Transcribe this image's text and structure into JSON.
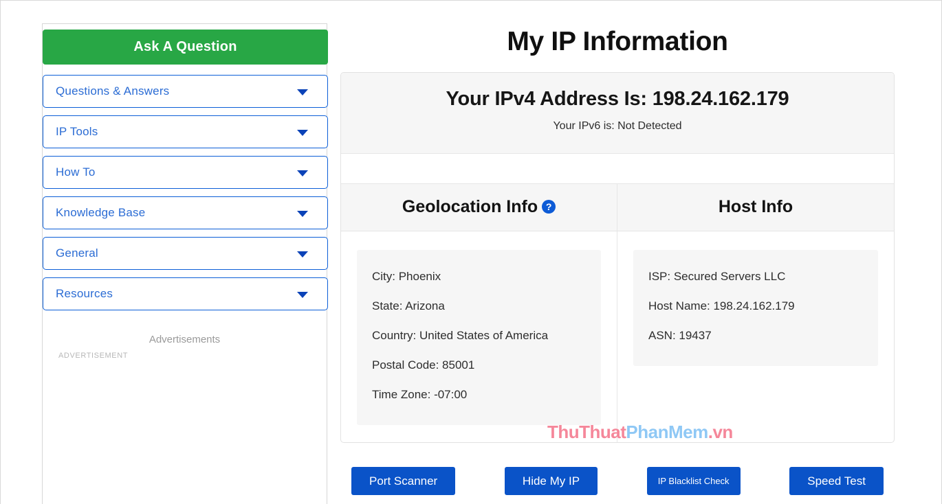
{
  "sidebar": {
    "ask_button": "Ask A Question",
    "nav_items": [
      {
        "label": "Questions & Answers",
        "icon": "chevron-down-icon"
      },
      {
        "label": "IP Tools",
        "icon": "chevron-down-icon"
      },
      {
        "label": "How To",
        "icon": "chevron-down-icon"
      },
      {
        "label": "Knowledge Base",
        "icon": "chevron-down-icon"
      },
      {
        "label": "General",
        "icon": "chevron-down-icon"
      },
      {
        "label": "Resources",
        "icon": "chevron-down-icon"
      }
    ],
    "ads_label": "Advertisements",
    "ads_small_label": "ADVERTISEMENT"
  },
  "main": {
    "page_title": "My IP Information",
    "ipv4_line": "Your IPv4 Address Is: 198.24.162.179",
    "ipv6_line": "Your IPv6 is: Not Detected",
    "geolocation": {
      "heading": "Geolocation Info",
      "help_icon": "question-mark-icon",
      "help_glyph": "?",
      "rows": [
        "City: Phoenix",
        "State: Arizona",
        "Country: United States of America",
        "Postal Code: 85001",
        "Time Zone: -07:00"
      ]
    },
    "host": {
      "heading": "Host Info",
      "rows": [
        "ISP: Secured Servers LLC",
        "Host Name: 198.24.162.179",
        "ASN: 19437"
      ]
    },
    "watermark": {
      "part1": "ThuThuat",
      "part2": "PhanMem",
      "part3": ".vn"
    },
    "actions": [
      {
        "label": "Port Scanner",
        "size": "normal"
      },
      {
        "label": "Hide My IP",
        "size": "normal"
      },
      {
        "label": "IP Blacklist Check",
        "size": "small"
      },
      {
        "label": "Speed Test",
        "size": "normal"
      }
    ]
  },
  "colors": {
    "green_button": "#28a745",
    "blue_button": "#0a53c8",
    "nav_border": "#0b5ed7",
    "nav_text": "#2b6cd4",
    "panel_bg": "#f6f6f6",
    "watermark_pink": "#f5879a",
    "watermark_blue": "#8fc8f5"
  }
}
